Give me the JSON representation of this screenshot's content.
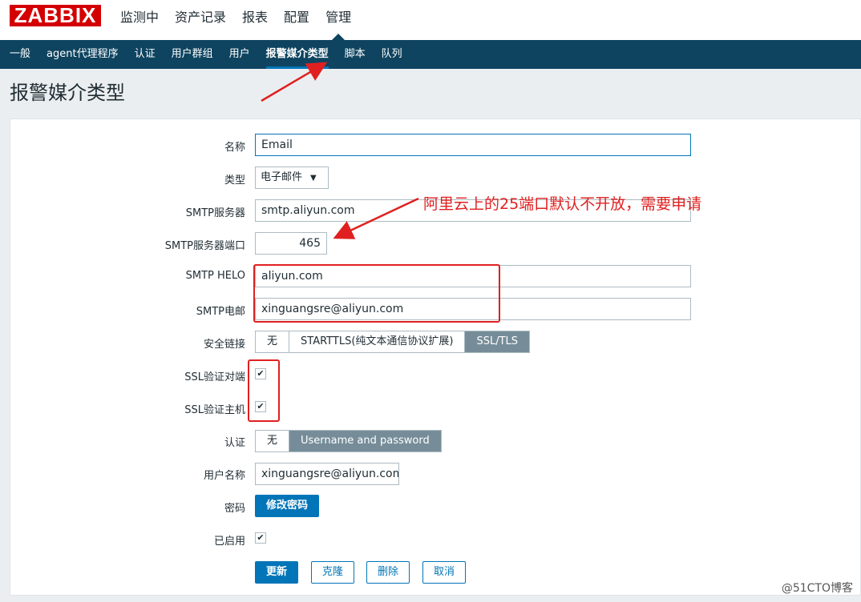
{
  "header": {
    "logo": "ZABBIX",
    "nav": [
      "监测中",
      "资产记录",
      "报表",
      "配置",
      "管理"
    ]
  },
  "subnav": [
    "一般",
    "agent代理程序",
    "认证",
    "用户群组",
    "用户",
    "报警媒介类型",
    "脚本",
    "队列"
  ],
  "page_title": "报警媒介类型",
  "form": {
    "name_label": "名称",
    "name_value": "Email",
    "type_label": "类型",
    "type_value": "电子邮件",
    "smtp_server_label": "SMTP服务器",
    "smtp_server_value": "smtp.aliyun.com",
    "smtp_port_label": "SMTP服务器端口",
    "smtp_port_value": "465",
    "smtp_helo_label": "SMTP HELO",
    "smtp_helo_value": "aliyun.com",
    "smtp_email_label": "SMTP电邮",
    "smtp_email_value": "xinguangsre@aliyun.com",
    "security_label": "安全链接",
    "security_options": [
      "无",
      "STARTTLS(纯文本通信协议扩展)",
      "SSL/TLS"
    ],
    "ssl_peer_label": "SSL验证对端",
    "ssl_host_label": "SSL验证主机",
    "auth_label": "认证",
    "auth_options": [
      "无",
      "Username and password"
    ],
    "username_label": "用户名称",
    "username_value": "xinguangsre@aliyun.com",
    "password_label": "密码",
    "password_button": "修改密码",
    "enabled_label": "已启用",
    "check_mark": "✔"
  },
  "buttons": {
    "update": "更新",
    "clone": "克隆",
    "delete": "删除",
    "cancel": "取消"
  },
  "annotation": "阿里云上的25端口默认不开放，需要申请",
  "watermark": "@51CTO博客"
}
